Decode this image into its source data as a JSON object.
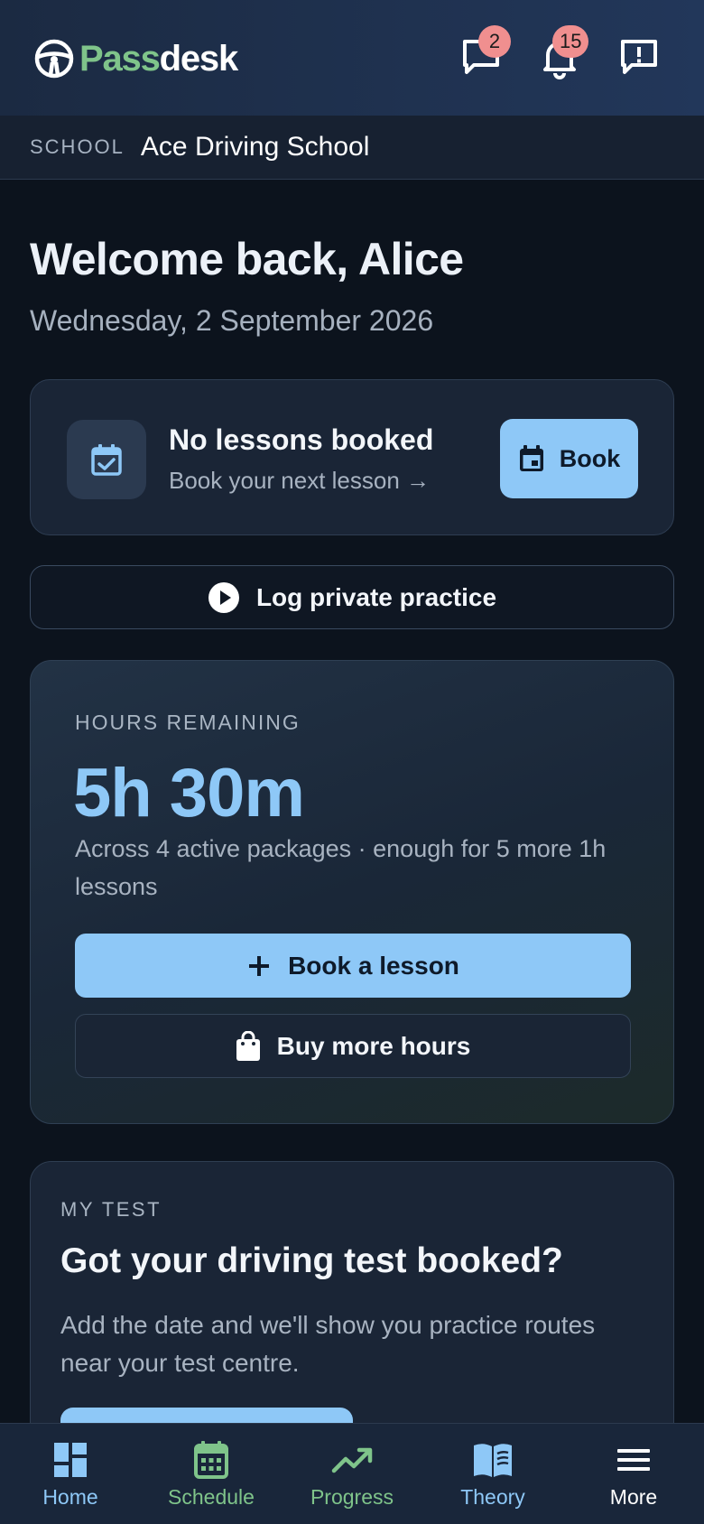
{
  "app": {
    "brand_part1": "Pass",
    "brand_part2": "desk",
    "brand_color": "#7fc48a",
    "accent_color": "#8ec8f7",
    "badge_color": "#f08f8f"
  },
  "header": {
    "messages": {
      "icon": "chat-bubble-icon",
      "badge": "2"
    },
    "notifications": {
      "icon": "bell-icon",
      "badge": "15"
    },
    "feedback": {
      "icon": "feedback-icon"
    }
  },
  "school": {
    "label": "SCHOOL",
    "name": "Ace Driving School"
  },
  "greeting": {
    "title": "Welcome back, Alice",
    "date": "Wednesday, 2 September 2026"
  },
  "next_lesson": {
    "icon": "calendar-check-icon",
    "title": "No lessons booked",
    "subtitle": "Book your next lesson →",
    "button_icon": "calendar-icon",
    "button_label": "Book"
  },
  "private_practice": {
    "icon": "play-circle-icon",
    "label": "Log private practice"
  },
  "hours": {
    "label": "HOURS REMAINING",
    "value": "5h 30m",
    "description": "Across 4 active packages · enough for 5 more 1h lessons",
    "primary_icon": "plus-icon",
    "primary_label": "Book a lesson",
    "secondary_icon": "shopping-bag-icon",
    "secondary_label": "Buy more hours"
  },
  "my_test": {
    "label": "MY TEST",
    "title": "Got your driving test booked?",
    "description": "Add the date and we'll show you practice routes near your test centre."
  },
  "bottom_nav": {
    "items": [
      {
        "label": "Home",
        "icon": "grid-icon",
        "color": "#8ec8f7"
      },
      {
        "label": "Schedule",
        "icon": "calendar-icon",
        "color": "#7fc48a"
      },
      {
        "label": "Progress",
        "icon": "trending-up-icon",
        "color": "#7fc48a"
      },
      {
        "label": "Theory",
        "icon": "book-icon",
        "color": "#8ec8f7"
      },
      {
        "label": "More",
        "icon": "menu-icon",
        "color": "#ffffff"
      }
    ]
  }
}
